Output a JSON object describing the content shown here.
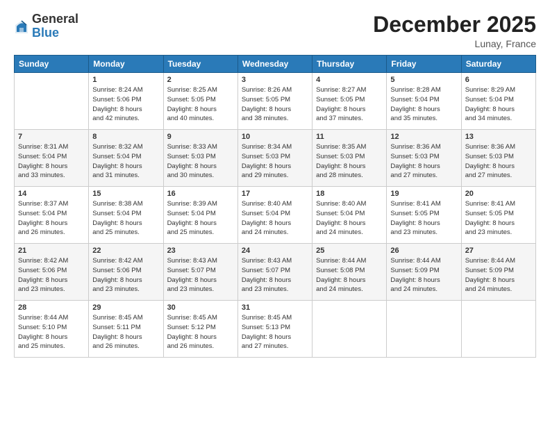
{
  "header": {
    "logo_general": "General",
    "logo_blue": "Blue",
    "month_title": "December 2025",
    "location": "Lunay, France"
  },
  "days_of_week": [
    "Sunday",
    "Monday",
    "Tuesday",
    "Wednesday",
    "Thursday",
    "Friday",
    "Saturday"
  ],
  "weeks": [
    [
      {
        "day": "",
        "content": ""
      },
      {
        "day": "1",
        "content": "Sunrise: 8:24 AM\nSunset: 5:06 PM\nDaylight: 8 hours\nand 42 minutes."
      },
      {
        "day": "2",
        "content": "Sunrise: 8:25 AM\nSunset: 5:05 PM\nDaylight: 8 hours\nand 40 minutes."
      },
      {
        "day": "3",
        "content": "Sunrise: 8:26 AM\nSunset: 5:05 PM\nDaylight: 8 hours\nand 38 minutes."
      },
      {
        "day": "4",
        "content": "Sunrise: 8:27 AM\nSunset: 5:05 PM\nDaylight: 8 hours\nand 37 minutes."
      },
      {
        "day": "5",
        "content": "Sunrise: 8:28 AM\nSunset: 5:04 PM\nDaylight: 8 hours\nand 35 minutes."
      },
      {
        "day": "6",
        "content": "Sunrise: 8:29 AM\nSunset: 5:04 PM\nDaylight: 8 hours\nand 34 minutes."
      }
    ],
    [
      {
        "day": "7",
        "content": "Sunrise: 8:31 AM\nSunset: 5:04 PM\nDaylight: 8 hours\nand 33 minutes."
      },
      {
        "day": "8",
        "content": "Sunrise: 8:32 AM\nSunset: 5:04 PM\nDaylight: 8 hours\nand 31 minutes."
      },
      {
        "day": "9",
        "content": "Sunrise: 8:33 AM\nSunset: 5:03 PM\nDaylight: 8 hours\nand 30 minutes."
      },
      {
        "day": "10",
        "content": "Sunrise: 8:34 AM\nSunset: 5:03 PM\nDaylight: 8 hours\nand 29 minutes."
      },
      {
        "day": "11",
        "content": "Sunrise: 8:35 AM\nSunset: 5:03 PM\nDaylight: 8 hours\nand 28 minutes."
      },
      {
        "day": "12",
        "content": "Sunrise: 8:36 AM\nSunset: 5:03 PM\nDaylight: 8 hours\nand 27 minutes."
      },
      {
        "day": "13",
        "content": "Sunrise: 8:36 AM\nSunset: 5:03 PM\nDaylight: 8 hours\nand 27 minutes."
      }
    ],
    [
      {
        "day": "14",
        "content": "Sunrise: 8:37 AM\nSunset: 5:04 PM\nDaylight: 8 hours\nand 26 minutes."
      },
      {
        "day": "15",
        "content": "Sunrise: 8:38 AM\nSunset: 5:04 PM\nDaylight: 8 hours\nand 25 minutes."
      },
      {
        "day": "16",
        "content": "Sunrise: 8:39 AM\nSunset: 5:04 PM\nDaylight: 8 hours\nand 25 minutes."
      },
      {
        "day": "17",
        "content": "Sunrise: 8:40 AM\nSunset: 5:04 PM\nDaylight: 8 hours\nand 24 minutes."
      },
      {
        "day": "18",
        "content": "Sunrise: 8:40 AM\nSunset: 5:04 PM\nDaylight: 8 hours\nand 24 minutes."
      },
      {
        "day": "19",
        "content": "Sunrise: 8:41 AM\nSunset: 5:05 PM\nDaylight: 8 hours\nand 23 minutes."
      },
      {
        "day": "20",
        "content": "Sunrise: 8:41 AM\nSunset: 5:05 PM\nDaylight: 8 hours\nand 23 minutes."
      }
    ],
    [
      {
        "day": "21",
        "content": "Sunrise: 8:42 AM\nSunset: 5:06 PM\nDaylight: 8 hours\nand 23 minutes."
      },
      {
        "day": "22",
        "content": "Sunrise: 8:42 AM\nSunset: 5:06 PM\nDaylight: 8 hours\nand 23 minutes."
      },
      {
        "day": "23",
        "content": "Sunrise: 8:43 AM\nSunset: 5:07 PM\nDaylight: 8 hours\nand 23 minutes."
      },
      {
        "day": "24",
        "content": "Sunrise: 8:43 AM\nSunset: 5:07 PM\nDaylight: 8 hours\nand 23 minutes."
      },
      {
        "day": "25",
        "content": "Sunrise: 8:44 AM\nSunset: 5:08 PM\nDaylight: 8 hours\nand 24 minutes."
      },
      {
        "day": "26",
        "content": "Sunrise: 8:44 AM\nSunset: 5:09 PM\nDaylight: 8 hours\nand 24 minutes."
      },
      {
        "day": "27",
        "content": "Sunrise: 8:44 AM\nSunset: 5:09 PM\nDaylight: 8 hours\nand 24 minutes."
      }
    ],
    [
      {
        "day": "28",
        "content": "Sunrise: 8:44 AM\nSunset: 5:10 PM\nDaylight: 8 hours\nand 25 minutes."
      },
      {
        "day": "29",
        "content": "Sunrise: 8:45 AM\nSunset: 5:11 PM\nDaylight: 8 hours\nand 26 minutes."
      },
      {
        "day": "30",
        "content": "Sunrise: 8:45 AM\nSunset: 5:12 PM\nDaylight: 8 hours\nand 26 minutes."
      },
      {
        "day": "31",
        "content": "Sunrise: 8:45 AM\nSunset: 5:13 PM\nDaylight: 8 hours\nand 27 minutes."
      },
      {
        "day": "",
        "content": ""
      },
      {
        "day": "",
        "content": ""
      },
      {
        "day": "",
        "content": ""
      }
    ]
  ]
}
